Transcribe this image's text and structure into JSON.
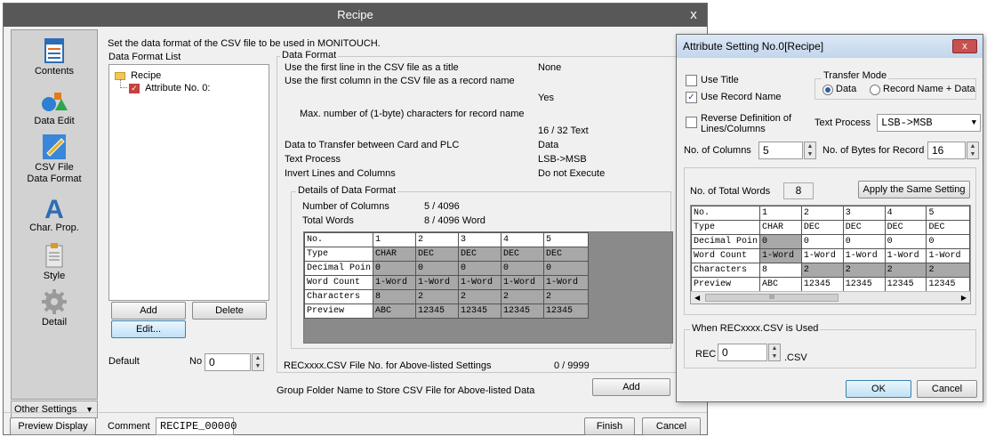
{
  "window": {
    "title": "Recipe",
    "close_label": "x"
  },
  "sidebar": {
    "items": [
      {
        "label": "Contents",
        "icon": "contents-icon"
      },
      {
        "label": "Data Edit",
        "icon": "data-edit-icon"
      },
      {
        "label": "CSV File Data Format",
        "label_line1": "CSV File",
        "label_line2": "Data Format",
        "icon": "csv-file-icon",
        "selected": true
      },
      {
        "label": "Char. Prop.",
        "icon": "char-prop-icon"
      },
      {
        "label": "Style",
        "icon": "style-icon"
      },
      {
        "label": "Detail",
        "icon": "detail-icon"
      }
    ],
    "other_settings": "Other Settings"
  },
  "main": {
    "intro": "Set the data format of the CSV file to be used in MONITOUCH.",
    "list_title": "Data Format List",
    "tree": {
      "root": "Recipe",
      "child": "Attribute No. 0:"
    },
    "add_label": "Add",
    "delete_label": "Delete",
    "edit_label": "Edit...",
    "default_label": "Default",
    "default_no_label": "No",
    "default_no_value": "0"
  },
  "format": {
    "title": "Data Format",
    "rows": [
      {
        "label": "Use the first line in the CSV file as a title",
        "value": "None"
      },
      {
        "label": "Use the first column in the CSV file as a record name",
        "value": "Yes"
      },
      {
        "label": "Max. number of (1-byte) characters for record name",
        "value": "16 / 32 Text"
      },
      {
        "label": "Data to Transfer between Card and PLC",
        "value": "Data"
      },
      {
        "label": "Text Process",
        "value": "LSB->MSB"
      },
      {
        "label": "Invert Lines and Columns",
        "value": "Do not Execute"
      }
    ],
    "details_title": "Details of Data Format",
    "num_columns_label": "Number of Columns",
    "num_columns_value": "5 / 4096",
    "total_words_label": "Total Words",
    "total_words_value": "8 / 4096 Word",
    "table": {
      "headers": [
        "No.",
        "1",
        "2",
        "3",
        "4",
        "5"
      ],
      "rows": [
        [
          "Type",
          "CHAR",
          "DEC",
          "DEC",
          "DEC",
          "DEC"
        ],
        [
          "Decimal Poin",
          "0",
          "0",
          "0",
          "0",
          "0"
        ],
        [
          "Word Count",
          "1-Word",
          "1-Word",
          "1-Word",
          "1-Word",
          "1-Word"
        ],
        [
          "Characters",
          "8",
          "2",
          "2",
          "2",
          "2"
        ],
        [
          "Preview",
          "ABC",
          "12345",
          "12345",
          "12345",
          "12345"
        ]
      ]
    },
    "recxxxx_label": "RECxxxx.CSV File No. for Above-listed Settings",
    "recxxxx_value": "0 / 9999",
    "group_folder_label": "Group Folder Name to Store CSV File for Above-listed Data",
    "add_label": "Add"
  },
  "bottom": {
    "preview_label": "Preview Display",
    "comment_label": "Comment",
    "comment_value": "RECIPE_00000",
    "finish_label": "Finish",
    "cancel_label": "Cancel"
  },
  "dialog": {
    "title": "Attribute Setting No.0[Recipe]",
    "close_label": "x",
    "use_title": {
      "label": "Use Title",
      "checked": false
    },
    "use_record_name": {
      "label": "Use Record Name",
      "checked": true
    },
    "reverse": {
      "label_line1": "Reverse Definition of",
      "label_line2": "Lines/Columns",
      "checked": false
    },
    "transfer_mode": {
      "title": "Transfer Mode",
      "options": [
        "Data",
        "Record Name + Data"
      ],
      "selected": "Data"
    },
    "text_process": {
      "label": "Text Process",
      "value": "LSB->MSB"
    },
    "num_columns": {
      "label": "No. of Columns",
      "value": "5"
    },
    "num_bytes": {
      "label": "No. of Bytes for Record",
      "value": "16"
    },
    "total_words": {
      "label": "No. of Total Words",
      "value": "8"
    },
    "apply_label": "Apply the Same Setting",
    "table": {
      "headers": [
        "No.",
        "1",
        "2",
        "3",
        "4",
        "5"
      ],
      "rows": [
        [
          "Type",
          "CHAR",
          "DEC",
          "DEC",
          "DEC",
          "DEC"
        ],
        [
          "Decimal Poin",
          "0",
          "0",
          "0",
          "0",
          "0"
        ],
        [
          "Word Count",
          "1-Word",
          "1-Word",
          "1-Word",
          "1-Word",
          "1-Word"
        ],
        [
          "Characters",
          "8",
          "2",
          "2",
          "2",
          "2"
        ],
        [
          "Preview",
          "ABC",
          "12345",
          "12345",
          "12345",
          "12345"
        ]
      ]
    },
    "scroll_mark": "III",
    "rec_group": {
      "title": "When RECxxxx.CSV is Used",
      "label": "REC",
      "value": "0",
      "suffix": ".CSV"
    },
    "ok_label": "OK",
    "cancel_label": "Cancel"
  }
}
